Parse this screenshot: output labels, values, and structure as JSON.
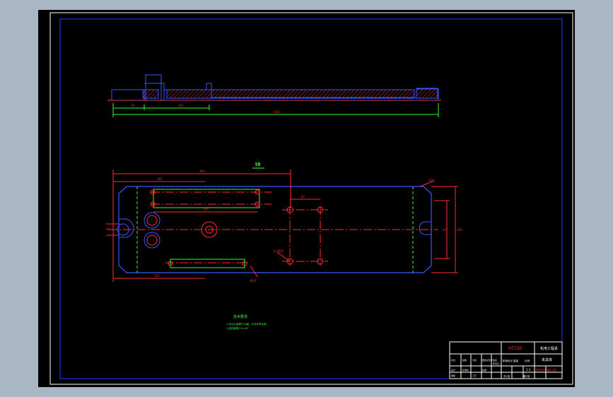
{
  "colors": {
    "background": "#a9b6c4",
    "canvas": "#000000",
    "frame": "#ffffff",
    "border": "#1d3cff",
    "outline": "#3a55ff",
    "centerline": "#ff2b2b",
    "dimension": "#ff2b2b",
    "highlight": "#32ff32"
  },
  "top_view": {
    "dims": {
      "overall": "654",
      "left": "61",
      "mid": "167",
      "center": ""
    },
    "dims_vertical": {
      "h1": "40",
      "h2": "15"
    }
  },
  "plan_view": {
    "section_label": "I9",
    "dims": {
      "top_overall": "360",
      "top_left": "187",
      "inner_mid": "145",
      "right_pair": "82",
      "bottom_left": "150",
      "left_small": "R8",
      "radius": "R20",
      "height_right": "100",
      "slot": "40",
      "hole_note": "2×Φ14",
      "hole_note2": "Φ20"
    }
  },
  "notes": {
    "title": "技术要求",
    "line1": "1.未注公差按IT14级，不允许有毛刺。",
    "line2": "2.锐边倒角0.5×45°"
  },
  "title_block": {
    "material": "HT150",
    "company": "机电工程系",
    "part_name": "夹具体",
    "drawing_no": "ZDJG100-10",
    "scale": "1:1",
    "sheet": "共1张",
    "sheet2": "第1张",
    "row_labels": [
      "标记",
      "处数",
      "分区",
      "更改文件号",
      "签名",
      "年月日"
    ],
    "row2": [
      "设计",
      "标准化",
      "审核",
      "工艺",
      "批准"
    ],
    "stage": "阶段标记",
    "weight": "重量",
    "ratio": "比例"
  }
}
